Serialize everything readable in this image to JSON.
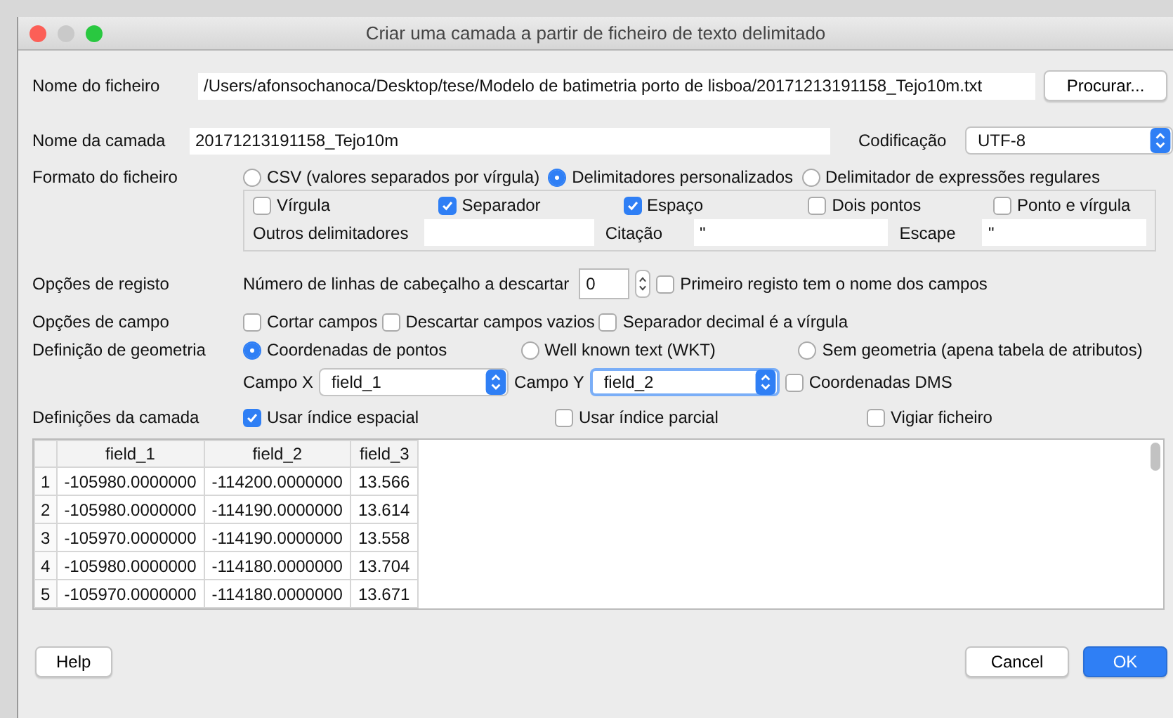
{
  "window": {
    "title": "Criar uma camada a partir de ficheiro de texto delimitado"
  },
  "file_name": {
    "label": "Nome do ficheiro",
    "value": "/Users/afonsochanoca/Desktop/tese/Modelo de batimetria porto de lisboa/20171213191158_Tejo10m.txt",
    "button": "Procurar..."
  },
  "layer_name": {
    "label": "Nome da camada",
    "value": "20171213191158_Tejo10m"
  },
  "encoding": {
    "label": "Codificação",
    "value": "UTF-8"
  },
  "file_format": {
    "label": "Formato do ficheiro",
    "options": [
      {
        "label": "CSV (valores separados por vírgula)",
        "selected": false
      },
      {
        "label": "Delimitadores personalizados",
        "selected": true
      },
      {
        "label": "Delimitador de expressões regulares",
        "selected": false
      }
    ]
  },
  "delimiters": {
    "options": [
      {
        "label": "Vírgula",
        "checked": false
      },
      {
        "label": "Separador",
        "checked": true
      },
      {
        "label": "Espaço",
        "checked": true
      },
      {
        "label": "Dois pontos",
        "checked": false
      },
      {
        "label": "Ponto e vírgula",
        "checked": false
      }
    ],
    "fields": [
      {
        "label": "Outros delimitadores"
      },
      {
        "label": "Citação",
        "value": "\""
      },
      {
        "label": "Escape",
        "value": "\""
      }
    ]
  },
  "record_options": {
    "label": "Opções de registo",
    "header_lines_label": "Número de linhas de cabeçalho a descartar",
    "header_lines_value": "0",
    "first_record": {
      "label": "Primeiro registo tem o nome dos campos",
      "checked": false
    }
  },
  "field_options": {
    "label": "Opções de campo",
    "checkboxes": [
      {
        "label": "Cortar campos",
        "checked": false
      },
      {
        "label": "Descartar campos vazios",
        "checked": false
      },
      {
        "label": "Separador decimal é a vírgula",
        "checked": false
      }
    ]
  },
  "geometry": {
    "label": "Definição de geometria",
    "options": [
      {
        "label": "Coordenadas de pontos",
        "selected": true
      },
      {
        "label": "Well known text (WKT)",
        "selected": false
      },
      {
        "label": "Sem geometria (apena tabela de atributos)",
        "selected": false
      }
    ],
    "x_field": {
      "label": "Campo X",
      "value": "field_1",
      "focused": false
    },
    "y_field": {
      "label": "Campo Y",
      "value": "field_2",
      "focused": true
    },
    "dms": {
      "label": "Coordenadas DMS",
      "checked": false
    }
  },
  "layer_settings": {
    "label": "Definições da camada",
    "checkboxes": [
      {
        "label": "Usar índice espacial",
        "checked": true
      },
      {
        "label": "Usar índice parcial",
        "checked": false
      },
      {
        "label": "Vigiar ficheiro",
        "checked": false
      }
    ]
  },
  "table": {
    "columns": [
      "field_1",
      "field_2",
      "field_3"
    ],
    "rows": [
      {
        "number": "1",
        "cells": [
          "-105980.0000000",
          "-114200.0000000",
          "13.566"
        ]
      },
      {
        "number": "2",
        "cells": [
          "-105980.0000000",
          "-114190.0000000",
          "13.614"
        ]
      },
      {
        "number": "3",
        "cells": [
          "-105970.0000000",
          "-114190.0000000",
          "13.558"
        ]
      },
      {
        "number": "4",
        "cells": [
          "-105980.0000000",
          "-114180.0000000",
          "13.704"
        ]
      },
      {
        "number": "5",
        "cells": [
          "-105970.0000000",
          "-114180.0000000",
          "13.671"
        ]
      }
    ]
  },
  "buttons": [
    {
      "label": "Help",
      "primary": false
    },
    {
      "label": "Cancel",
      "primary": false
    },
    {
      "label": "OK",
      "primary": true
    }
  ]
}
